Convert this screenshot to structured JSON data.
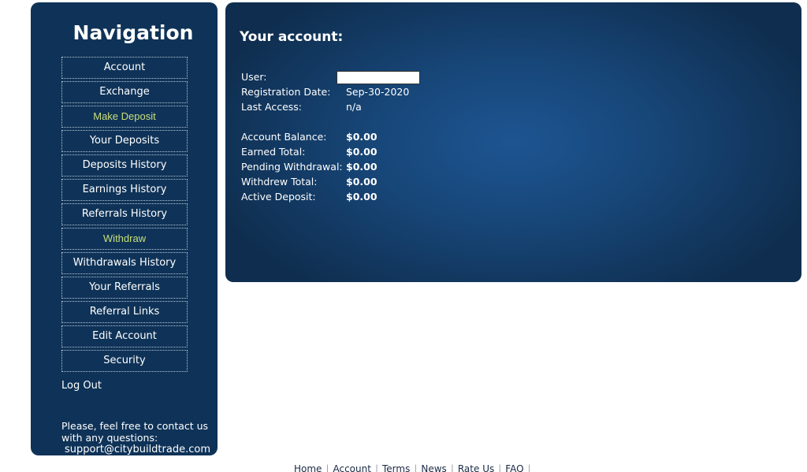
{
  "sidebar": {
    "title": "Navigation",
    "items": [
      {
        "label": "Account"
      },
      {
        "label": "Exchange"
      },
      {
        "label": "Make Deposit"
      },
      {
        "label": "Your Deposits"
      },
      {
        "label": "Deposits History"
      },
      {
        "label": "Earnings History"
      },
      {
        "label": "Referrals History"
      },
      {
        "label": "Withdraw"
      },
      {
        "label": "Withdrawals History"
      },
      {
        "label": "Your Referrals"
      },
      {
        "label": "Referral Links"
      },
      {
        "label": "Edit Account"
      },
      {
        "label": "Security"
      }
    ],
    "logout": "Log Out",
    "contact_text_1": "Please, feel free to contact us",
    "contact_text_2": "with any questions:",
    "contact_email": "support@citybuildtrade.com"
  },
  "account": {
    "title": "Your account:",
    "user_label": "User:",
    "user_value": "",
    "registration_label": "Registration Date:",
    "registration_value": "Sep-30-2020",
    "last_access_label": "Last Access:",
    "last_access_value": "n/a",
    "balance_label": "Account Balance:",
    "balance_value": "$0.00",
    "earned_label": "Earned Total:",
    "earned_value": "$0.00",
    "pending_label": "Pending Withdrawal:",
    "pending_value": "$0.00",
    "withdrew_label": "Withdrew Total:",
    "withdrew_value": "$0.00",
    "active_label": "Active Deposit:",
    "active_value": "$0.00"
  },
  "footer": {
    "links": [
      "Home",
      "Account",
      "Terms",
      "News",
      "Rate Us",
      "FAQ"
    ]
  },
  "colors": {
    "sidebar_bg": "#0f3358",
    "highlight_text": "#c9df7a",
    "panel_center": "#1d5592",
    "panel_edge": "#0f2e4f"
  }
}
